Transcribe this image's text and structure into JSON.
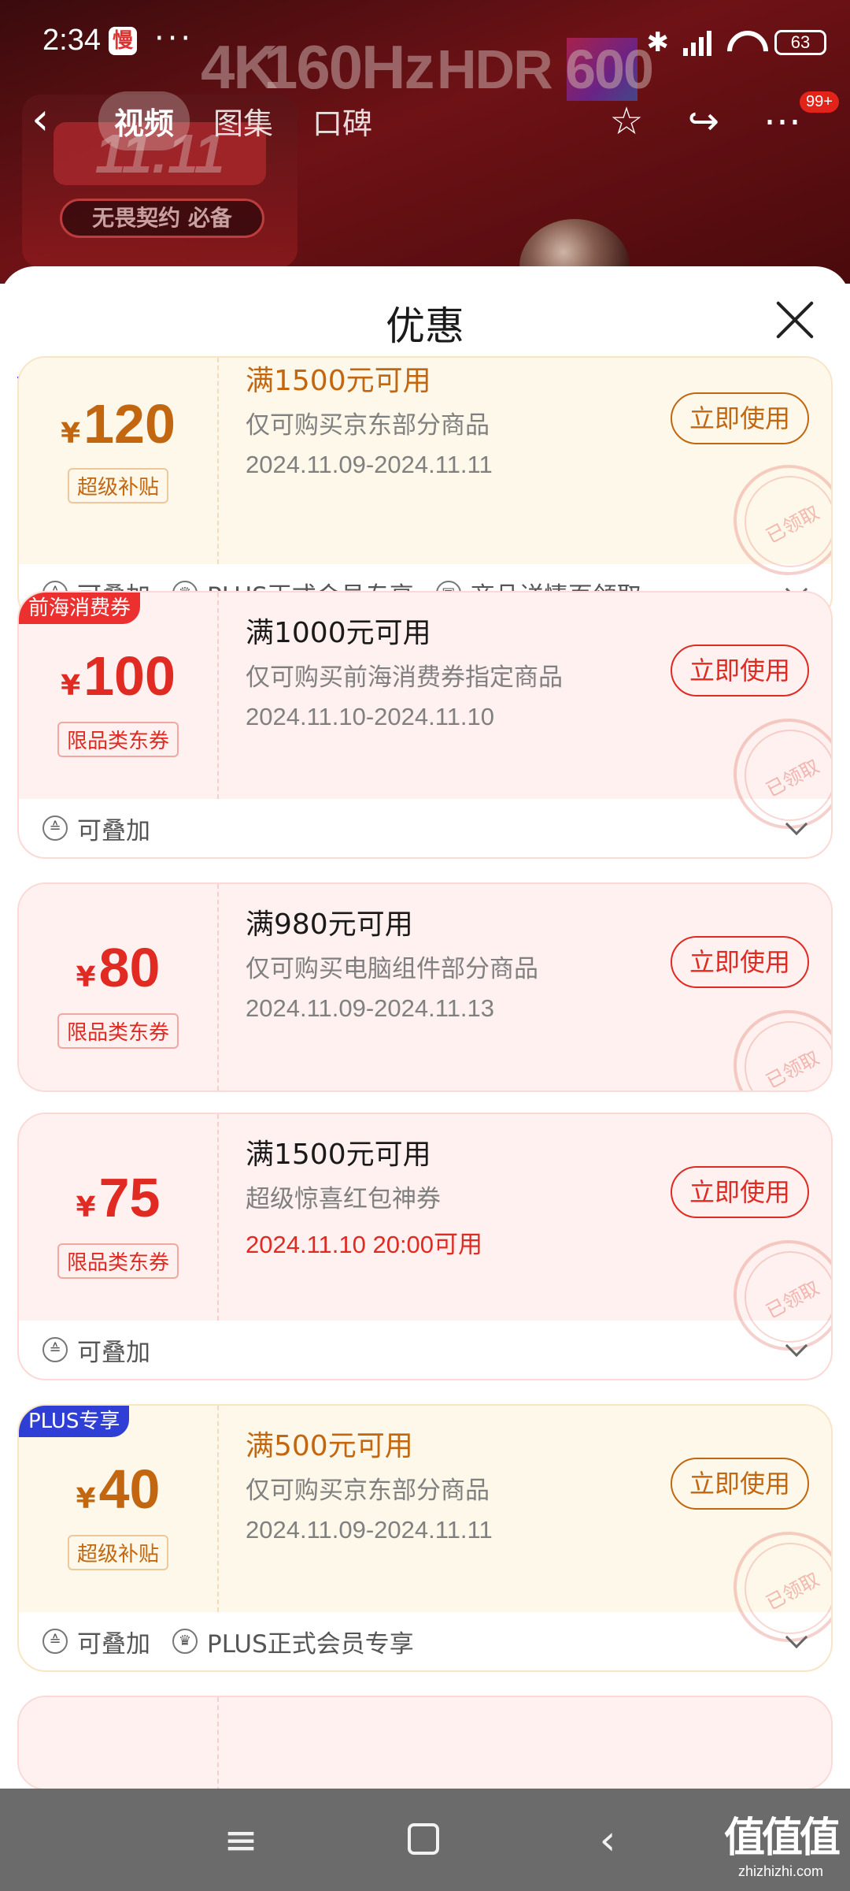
{
  "status_bar": {
    "time": "2:34",
    "app_icon": "慢",
    "dots": "···",
    "battery": "63"
  },
  "nav": {
    "tabs": [
      "视频",
      "图集",
      "口碑"
    ],
    "active_tab": 0,
    "cart_badge": "99+"
  },
  "background": {
    "specs": [
      "4K",
      "160Hz",
      "HDR 600"
    ],
    "promo_title": "11.11",
    "promo_slogan": "无畏契约 必备"
  },
  "sheet": {
    "title": "优惠",
    "coupons": [
      {
        "theme": "gold",
        "currency": "¥",
        "amount": "120",
        "type": "超级补贴",
        "condition": "满1500元可用",
        "scope": "仅可购买京东部分商品",
        "date": "2024.11.09-2024.11.11",
        "button": "立即使用",
        "stamp": "已领取",
        "features": [
          "可叠加",
          "PLUS正式会员专享",
          "商品详情页领取"
        ]
      },
      {
        "theme": "red",
        "corner_tag": "前海消费券",
        "currency": "¥",
        "amount": "100",
        "type": "限品类东券",
        "condition": "满1000元可用",
        "scope": "仅可购买前海消费券指定商品",
        "date": "2024.11.10-2024.11.10",
        "button": "立即使用",
        "stamp": "已领取",
        "features": [
          "可叠加"
        ]
      },
      {
        "theme": "red",
        "currency": "¥",
        "amount": "80",
        "type": "限品类东券",
        "condition": "满980元可用",
        "scope": "仅可购买电脑组件部分商品",
        "date": "2024.11.09-2024.11.13",
        "button": "立即使用",
        "stamp": "已领取",
        "features": []
      },
      {
        "theme": "red",
        "currency": "¥",
        "amount": "75",
        "type": "限品类东券",
        "condition": "满1500元可用",
        "scope": "超级惊喜红包神券",
        "date": "2024.11.10 20:00可用",
        "date_highlight": true,
        "button": "立即使用",
        "stamp": "已领取",
        "features": [
          "可叠加"
        ]
      },
      {
        "theme": "gold",
        "corner_tag": "PLUS专享",
        "currency": "¥",
        "amount": "40",
        "type": "超级补贴",
        "condition": "满500元可用",
        "scope": "仅可购买京东部分商品",
        "date": "2024.11.09-2024.11.11",
        "button": "立即使用",
        "stamp": "已领取",
        "features": [
          "可叠加",
          "PLUS正式会员专享"
        ]
      }
    ]
  },
  "watermark": {
    "logo": "值值值",
    "url": "zhizhizhi.com"
  },
  "colors": {
    "gold": "#c2670f",
    "red": "#e02a22",
    "plus_blue": "#2f3fd6"
  }
}
